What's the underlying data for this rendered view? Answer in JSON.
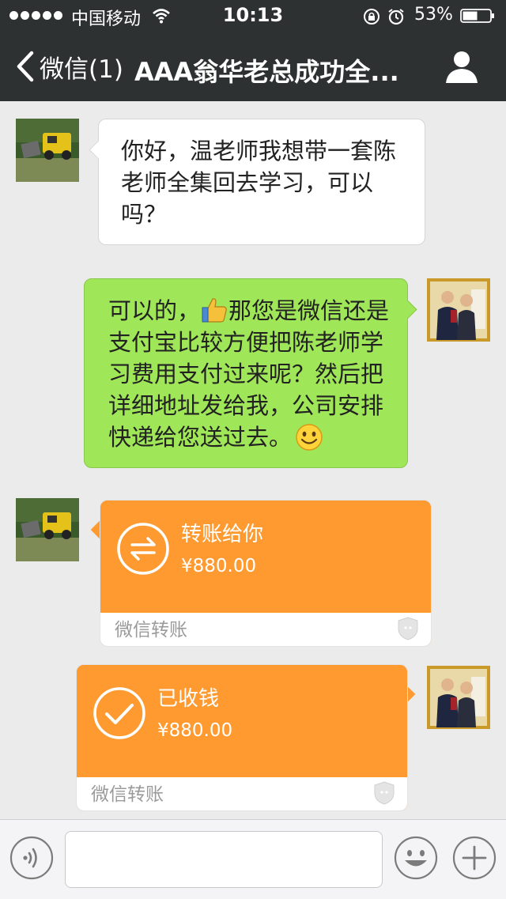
{
  "status": {
    "carrier": "中国移动",
    "time": "10:13",
    "battery": "53%"
  },
  "nav": {
    "back_label": "微信(1)",
    "title": "AAA翁华老总成功全..."
  },
  "messages": [
    {
      "side": "left",
      "avatar": "jeep-avatar",
      "text": "你好，温老师我想带一套陈老师全集回去学习，可以吗？"
    },
    {
      "side": "right",
      "avatar": "men-avatar",
      "text_before": "可以的，",
      "emoji": "thumbs-up-icon",
      "text_after": "那您是微信还是支付宝比较方便把陈老师学习费用支付过来呢？然后把详细地址发给我，公司安排快递给您送过去。",
      "end_emoji": "smile-icon"
    }
  ],
  "transfers": [
    {
      "side": "left",
      "icon": "transfer-arrows-icon",
      "title": "转账给你",
      "amount": "¥880.00",
      "footer": "微信转账"
    },
    {
      "side": "right",
      "icon": "checkmark-icon",
      "title": "已收钱",
      "amount": "¥880.00",
      "footer": "微信转账"
    }
  ],
  "colors": {
    "header": "#2e3132",
    "background": "#ebebeb",
    "bubble_green": "#9fe658",
    "transfer_orange": "#fe9a2f"
  }
}
